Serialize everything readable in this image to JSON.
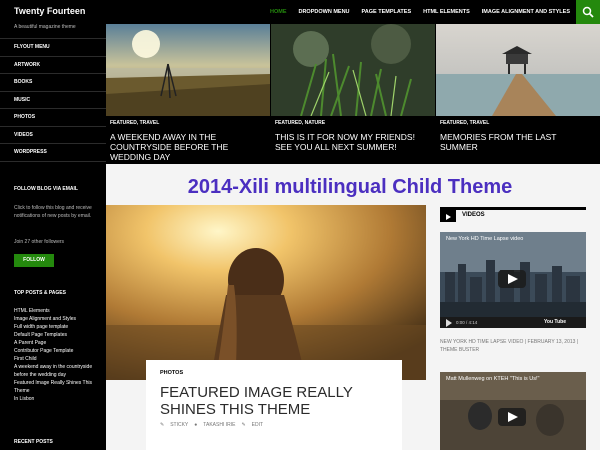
{
  "header": {
    "site_title": "Twenty Fourteen",
    "nav": [
      "HOME",
      "DROPDOWN MENU",
      "PAGE TEMPLATES",
      "HTML ELEMENTS",
      "IMAGE ALIGNMENT AND STYLES"
    ],
    "active_nav_index": 0
  },
  "sidebar": {
    "tagline": "A beautiful magazine theme",
    "menu": [
      "FLYOUT MENU",
      "ARTWORK",
      "BOOKS",
      "MUSIC",
      "PHOTOS",
      "VIDEOS",
      "WORDPRESS"
    ],
    "follow_title": "FOLLOW BLOG VIA EMAIL",
    "follow_text": "Click to follow this blog and receive notifications of new posts by email.",
    "followers_text": "Join 27 other followers",
    "follow_button": "FOLLOW",
    "top_posts_title": "TOP POSTS & PAGES",
    "top_posts": [
      "HTML Elements",
      "Image Alignment and Styles",
      "Full width page template",
      "Default Page Templates",
      "A Parent Page",
      "Contributor Page Template",
      "First Child",
      "A weekend away in the countryside before the wedding day",
      "Featured Image Really Shines This Theme",
      "In Lisbon"
    ],
    "recent_posts_title": "RECENT POSTS"
  },
  "featured": [
    {
      "category": "FEATURED, TRAVEL",
      "title": "A WEEKEND AWAY IN THE COUNTRYSIDE BEFORE THE WEDDING DAY"
    },
    {
      "category": "FEATURED, NATURE",
      "title": "THIS IS IT FOR NOW MY FRIENDS! SEE YOU ALL NEXT SUMMER!"
    },
    {
      "category": "FEATURED, TRAVEL",
      "title": "MEMORIES FROM THE LAST SUMMER"
    }
  ],
  "banner": "2014-Xili multilingual Child Theme",
  "post": {
    "category": "PHOTOS",
    "title": "FEATURED IMAGE REALLY SHINES THIS THEME",
    "meta_sticky": "STICKY",
    "meta_author": "TAKASHI IRIE",
    "meta_edit": "EDIT"
  },
  "right_widget": {
    "title": "VIDEOS",
    "video1_title": "New York HD Time Lapse video",
    "video1_time": "0:00 / 4:14",
    "video1_caption": "NEW YORK HD TIME LAPSE VIDEO | FEBRUARY 13, 2013 | THEME BUSTER",
    "video2_title": "Matt Mullenweg on KTEH \"This is Us!\"",
    "youtube_label": "You Tube"
  },
  "colors": {
    "accent": "#24890d",
    "banner": "#4b2fc0",
    "background": "#000000"
  }
}
